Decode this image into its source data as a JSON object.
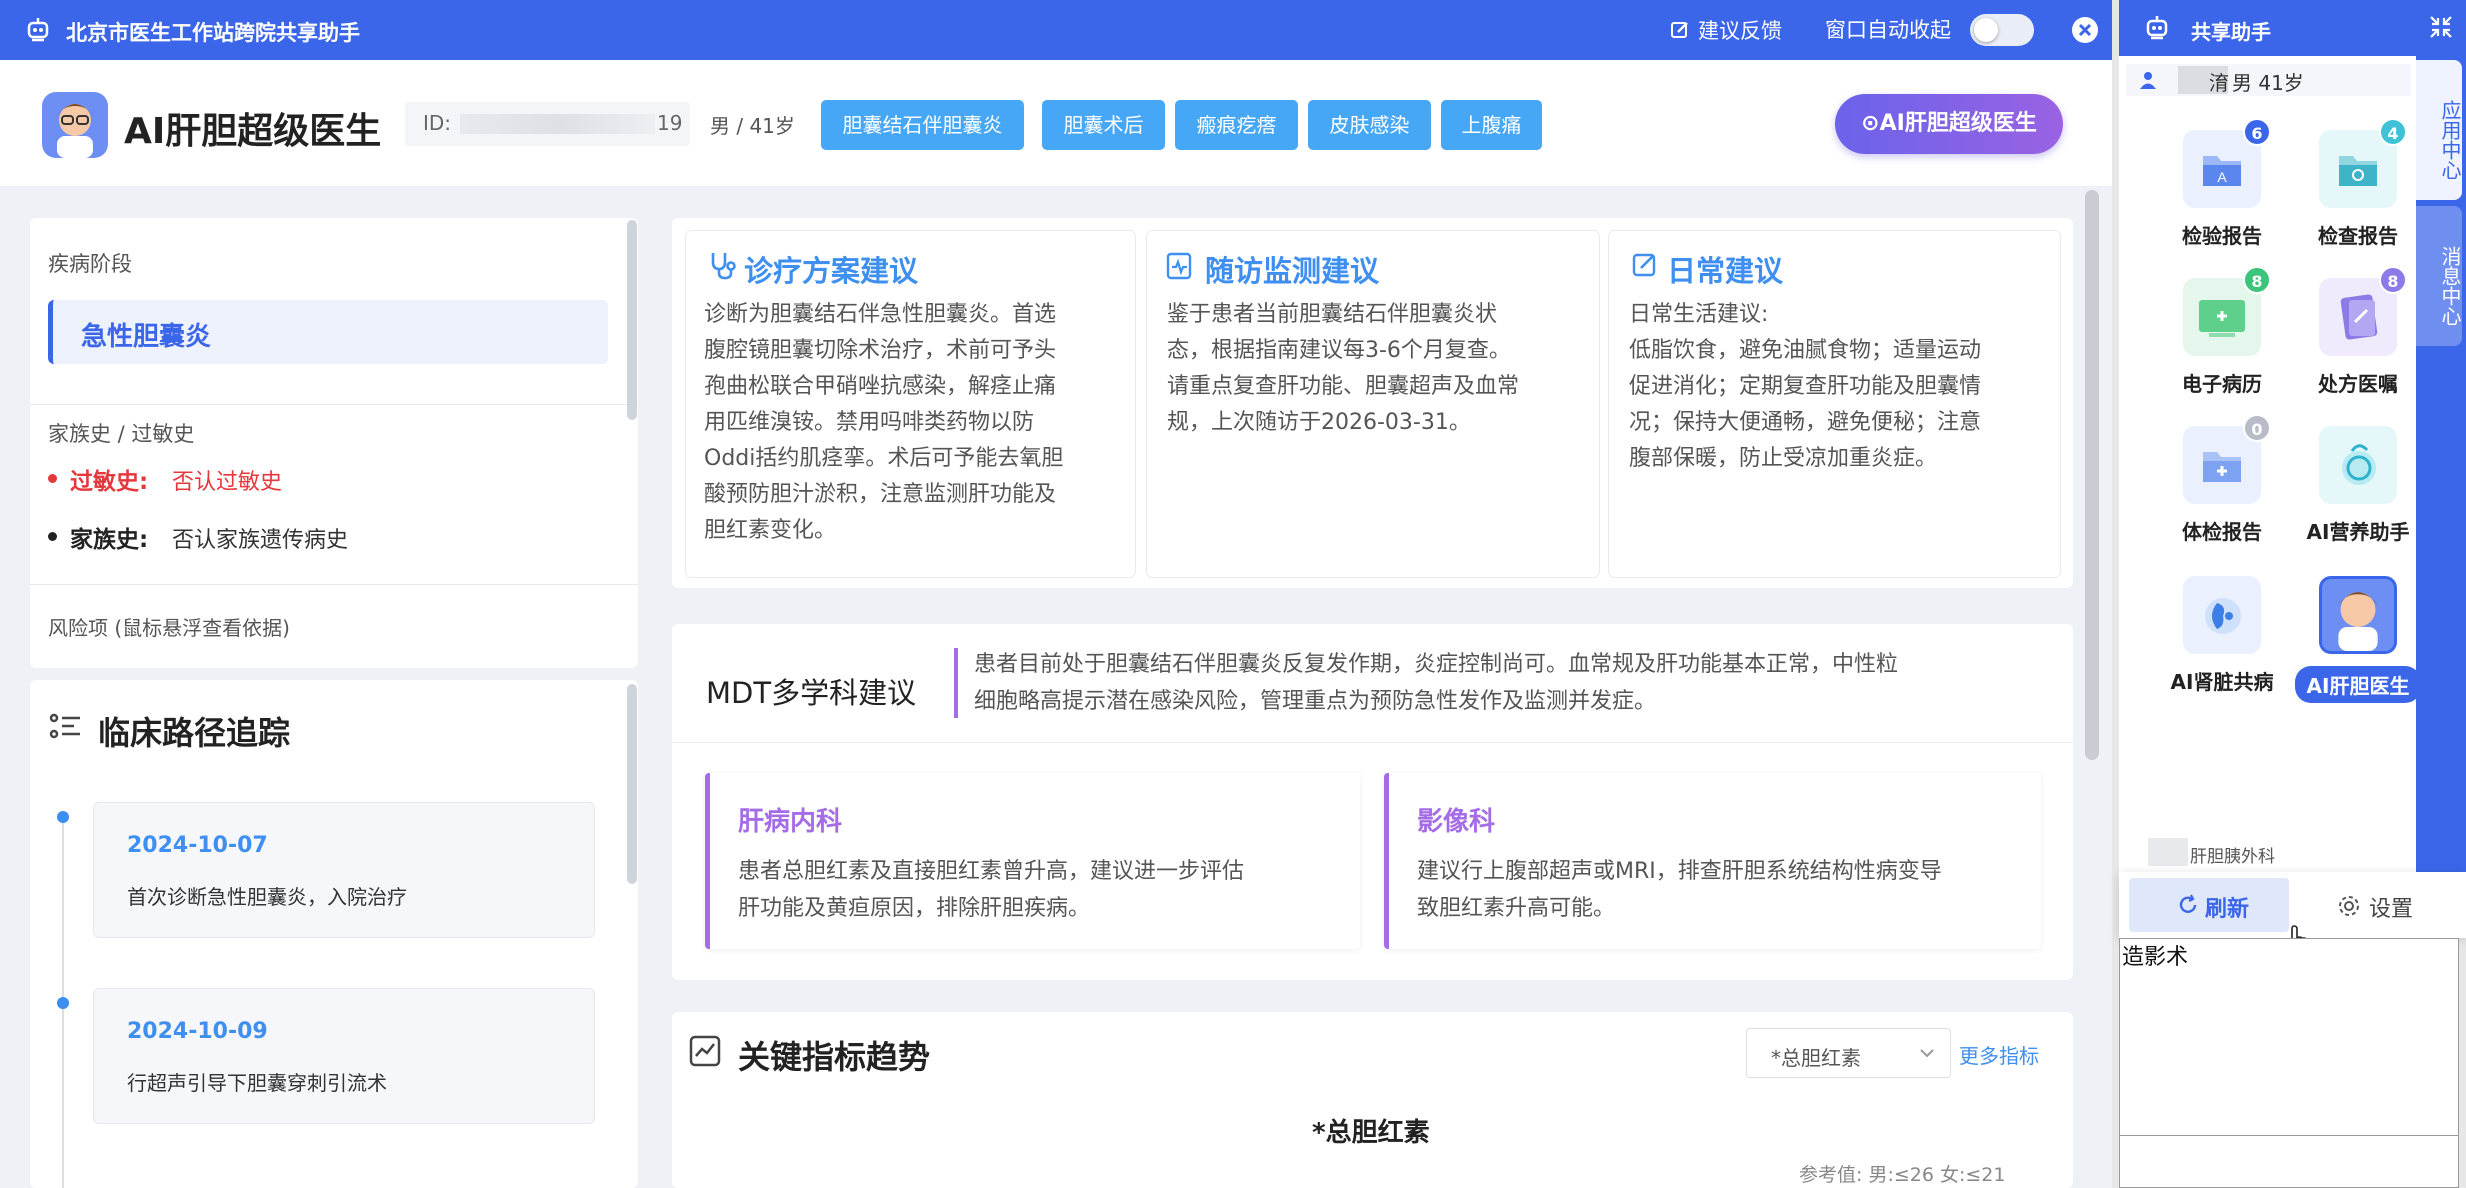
{
  "titlebar": {
    "title": "北京市医生工作站跨院共享助手",
    "feedback": "建议反馈",
    "auto_collapse": "窗口自动收起"
  },
  "header": {
    "app_name": "AI肝胆超级医生",
    "id_label": "ID:",
    "id_suffix": "19",
    "gender_age": "男 / 41岁",
    "tags": [
      "胆囊结石伴胆囊炎",
      "胆囊术后",
      "瘢痕疙瘩",
      "皮肤感染",
      "上腹痛"
    ],
    "ai_button": "⊙AI肝胆超级医生"
  },
  "left": {
    "stage_label": "疾病阶段",
    "stage_value": "急性胆囊炎",
    "history_label": "家族史 / 过敏史",
    "allergy_key": "过敏史:",
    "allergy_val": "否认过敏史",
    "family_key": "家族史:",
    "family_val": "否认家族遗传病史",
    "risk_label": "风险项 (鼠标悬浮查看依据)",
    "pathway_title": "临床路径追踪",
    "timeline": [
      {
        "date": "2024-10-07",
        "text": "首次诊断急性胆囊炎，入院治疗"
      },
      {
        "date": "2024-10-09",
        "text": "行超声引导下胆囊穿刺引流术"
      }
    ]
  },
  "advice": {
    "treatment": {
      "title": "诊疗方案建议",
      "lines": [
        "诊断为胆囊结石伴急性胆囊炎。首选",
        "腹腔镜胆囊切除术治疗，术前可予头",
        "孢曲松联合甲硝唑抗感染，解痉止痛",
        "用匹维溴铵。禁用吗啡类药物以防",
        "Oddi括约肌痉挛。术后可予能去氧胆",
        "酸预防胆汁淤积，注意监测肝功能及",
        "胆红素变化。"
      ]
    },
    "followup": {
      "title": "随访监测建议",
      "lines": [
        "鉴于患者当前胆囊结石伴胆囊炎状",
        "态，根据指南建议每3-6个月复查。",
        "请重点复查肝功能、胆囊超声及血常",
        "规，上次随访于2026-03-31。"
      ]
    },
    "daily": {
      "title": "日常建议",
      "lines": [
        "日常生活建议:",
        "低脂饮食，避免油腻食物；适量运动",
        "促进消化；定期复查肝功能及胆囊情",
        "况；保持大便通畅，避免便秘；注意",
        "腹部保暖，防止受凉加重炎症。"
      ]
    }
  },
  "mdt": {
    "title": "MDT多学科建议",
    "summary": [
      "患者目前处于胆囊结石伴胆囊炎反复发作期，炎症控制尚可。血常规及肝功能基本正常，中性粒",
      "细胞略高提示潜在感染风险，管理重点为预防急性发作及监测并发症。"
    ],
    "depts": [
      {
        "name": "肝病内科",
        "lines": [
          "患者总胆红素及直接胆红素曾升高，建议进一步评估",
          "肝功能及黄疸原因，排除肝胆疾病。"
        ]
      },
      {
        "name": "影像科",
        "lines": [
          "建议行上腹部超声或MRI，排查肝胆系统结构性病变导",
          "致胆红素升高可能。"
        ]
      }
    ]
  },
  "trend": {
    "title": "关键指标趋势",
    "select": "*总胆红素",
    "more": "更多指标",
    "chart_title": "*总胆红素",
    "reference": "参考值: 男:≤26 女:≤21"
  },
  "side": {
    "title": "共享助手",
    "patient_gender_age": "男 41岁",
    "patient_initial": "淯",
    "tab1": "应用中心",
    "tab2": "消息中心",
    "apps": [
      {
        "label": "检验报告",
        "badge": "6"
      },
      {
        "label": "检查报告",
        "badge": "4"
      },
      {
        "label": "电子病历",
        "badge": "8"
      },
      {
        "label": "处方医嘱",
        "badge": "8"
      },
      {
        "label": "体检报告",
        "badge": "0"
      },
      {
        "label": "AI营养助手",
        "badge": ""
      },
      {
        "label": "AI肾脏共病",
        "badge": ""
      },
      {
        "label": "AI肝胆医生",
        "badge": ""
      }
    ],
    "dept": "肝胆胰外科",
    "refresh": "刷新",
    "settings": "设置",
    "below_text": "造影术"
  },
  "colors": {
    "primary": "#3c66ea",
    "accent": "#3e8ff0",
    "tag": "#47a7f7",
    "purple": "#a46ce6",
    "danger": "#e4393c"
  }
}
